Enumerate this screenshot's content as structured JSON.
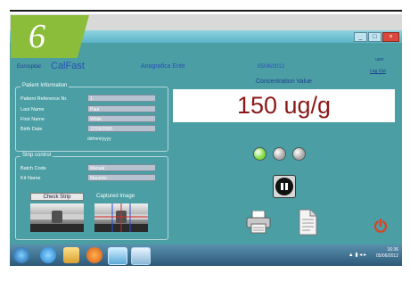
{
  "badge": {
    "number": "6"
  },
  "window": {
    "brand": "Eurospital",
    "app_name": "CalFast",
    "section": "Anagrafica Ente",
    "date": "05/06/2012",
    "user": "user",
    "logout": "Log Out",
    "controls": [
      "_",
      "□",
      "×"
    ]
  },
  "patient": {
    "title": "Patient Information",
    "fields": [
      {
        "label": "Patient Reference Nr.",
        "value": "1"
      },
      {
        "label": "Last Name",
        "value": "Paul"
      },
      {
        "label": "First Name",
        "value": "White"
      },
      {
        "label": "Birth Date",
        "value": "12/06/2000"
      }
    ],
    "date_hint": "dd/mm/yyyy"
  },
  "strip": {
    "title": "Strip control",
    "fields": [
      {
        "label": "Batch Code",
        "value": "Manual"
      },
      {
        "label": "Kit Name",
        "value": "Maurizio"
      }
    ],
    "check_button": "Check Strip",
    "captured_label": "Captured Image"
  },
  "concentration": {
    "label": "Concentration Value",
    "value": "150 ug/g"
  },
  "indicators": {
    "colors": [
      "#7ddc3c",
      "#a8a8a8",
      "#a8a8a8"
    ]
  },
  "icons": {
    "pause": "pause-icon",
    "print": "printer-icon",
    "document": "document-icon",
    "power": "power-icon"
  },
  "taskbar": {
    "icons": [
      "windows-start-icon",
      "internet-explorer-icon",
      "file-explorer-icon",
      "media-player-icon",
      "calfast-app-icon",
      "window-app-icon"
    ],
    "tray_text": "▲ ▮ ◂ ▸",
    "time": "16:36",
    "date": "05/06/2012"
  },
  "colors": {
    "window_bg": "#4a9ea4",
    "concentration_text": "#8b1818",
    "badge": "#8bbd3a",
    "power": "#e0401e"
  }
}
